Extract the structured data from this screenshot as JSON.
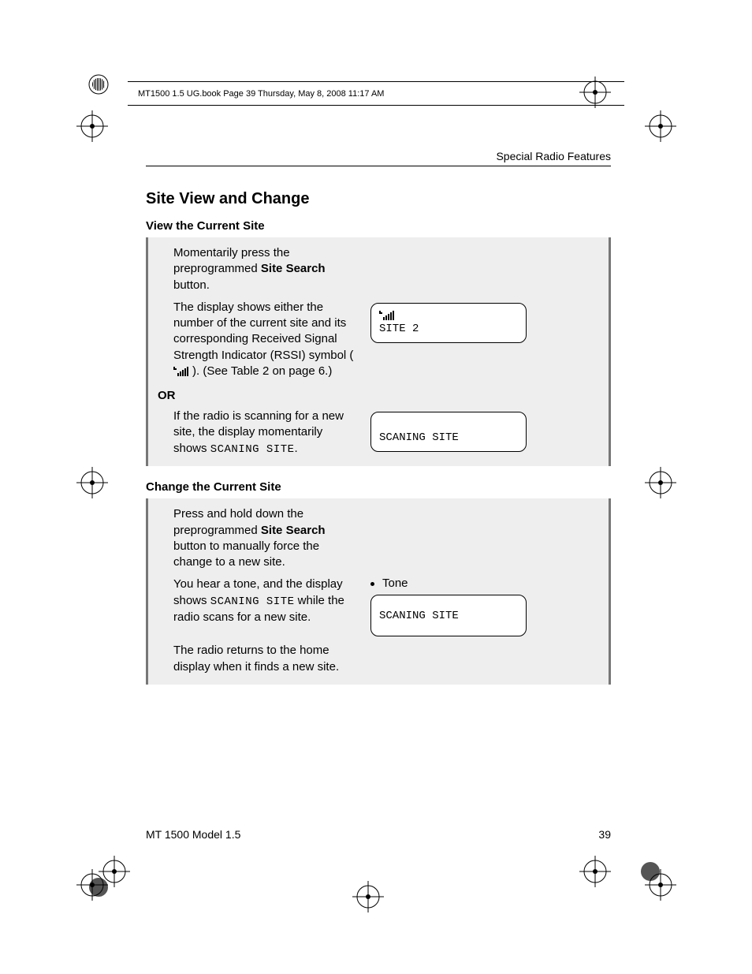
{
  "meta": {
    "running_head": "MT1500 1.5 UG.book  Page 39  Thursday, May 8, 2008  11:17 AM"
  },
  "header": {
    "section_label": "Special Radio Features"
  },
  "section": {
    "title": "Site View and Change",
    "view": {
      "title": "View the Current Site",
      "p1a": "Momentarily press the preprogrammed ",
      "p1b": "Site Search",
      "p1c": " button.",
      "p2a": "The display shows either the number of the current site and its corresponding Received Signal Strength Indicator (RSSI) symbol (",
      "p2b": "). (See Table 2 on page 6.)",
      "or": "OR",
      "p3a": "If the radio is scanning for a new site, the display momentarily shows ",
      "p3b": "SCANING SITE",
      "p3c": ".",
      "lcd1_text": "SITE 2",
      "lcd2_text": "SCANING SITE"
    },
    "change": {
      "title": "Change the Current Site",
      "p1a": "Press and hold down the preprogrammed ",
      "p1b": "Site Search",
      "p1c": " button to manually force the change to a new site.",
      "p2a": "You hear a tone, and the display shows ",
      "p2b": "SCANING SITE",
      "p2c": " while the radio scans for a new site.",
      "p3": "The radio returns to the home display when it finds a new site.",
      "tone_label": "Tone",
      "lcd_text": "SCANING SITE"
    }
  },
  "footer": {
    "model": "MT 1500 Model 1.5",
    "page_no": "39"
  }
}
